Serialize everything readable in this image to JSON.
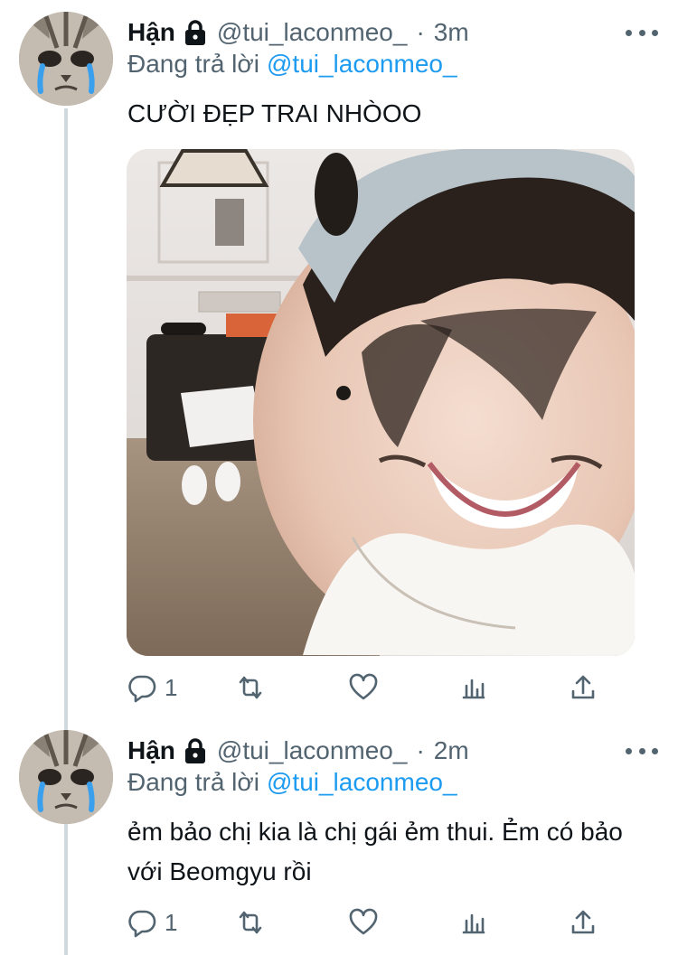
{
  "tweets": [
    {
      "name": "Hận",
      "handle": "@tui_laconmeo_",
      "separator": "·",
      "time": "3m",
      "reply_prefix": "Đang trả lời",
      "reply_mention": "@tui_laconmeo_",
      "text": "CƯỜI ĐẸP TRAI NHÒOO",
      "has_photo": true,
      "reply_count": "1"
    },
    {
      "name": "Hận",
      "handle": "@tui_laconmeo_",
      "separator": "·",
      "time": "2m",
      "reply_prefix": "Đang trả lời",
      "reply_mention": "@tui_laconmeo_",
      "text": "ẻm bảo chị kia là chị gái ẻm thui. Ẻm có bảo với Beomgyu rồi",
      "has_photo": false,
      "reply_count": "1"
    }
  ],
  "icons": {
    "reply": "reply-icon",
    "retweet": "retweet-icon",
    "like": "heart-icon",
    "analytics": "analytics-icon",
    "share": "share-icon",
    "lock": "lock-icon",
    "more": "more-icon"
  },
  "colors": {
    "accent": "#1d9bf0",
    "muted": "#536471",
    "text": "#0f1419",
    "thread_line": "#cfd9de"
  }
}
